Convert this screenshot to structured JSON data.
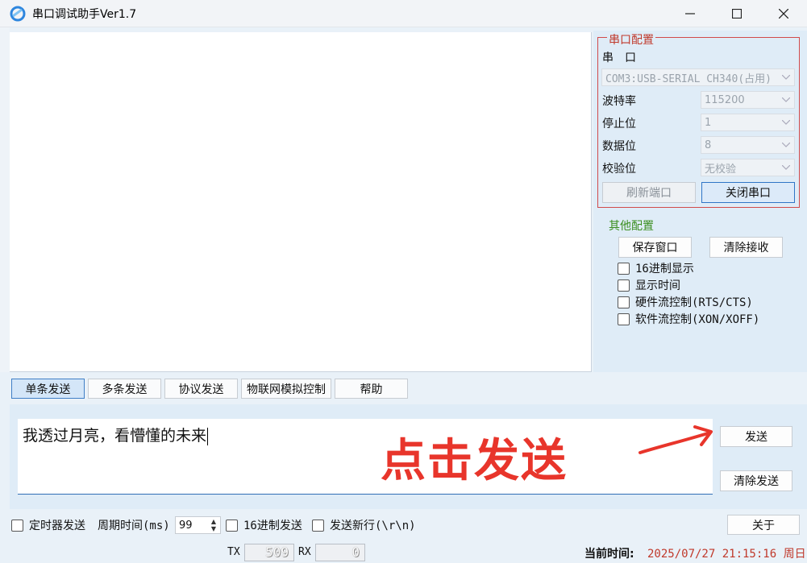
{
  "window": {
    "title": "串口调试助手Ver1.7",
    "controls": {
      "minimize": "—",
      "maximize": "☐",
      "close": "✕"
    }
  },
  "serial_config": {
    "group_title": "串口配置",
    "port_label": "串　口",
    "port_value": "COM3:USB-SERIAL CH340(占用)",
    "baud_label": "波特率",
    "baud_value": "115200",
    "stop_label": "停止位",
    "stop_value": "1",
    "data_label": "数据位",
    "data_value": "8",
    "parity_label": "校验位",
    "parity_value": "无校验",
    "refresh_button": "刷新端口",
    "close_port_button": "关闭串口"
  },
  "other_config": {
    "group_title": "其他配置",
    "save_window_button": "保存窗口",
    "clear_recv_button": "清除接收",
    "checkboxes": [
      {
        "label": "16进制显示",
        "checked": false
      },
      {
        "label": "显示时间",
        "checked": false
      },
      {
        "label": "硬件流控制(RTS/CTS)",
        "checked": false
      },
      {
        "label": "软件流控制(XON/XOFF)",
        "checked": false
      }
    ]
  },
  "tabs": [
    {
      "label": "单条发送",
      "active": true
    },
    {
      "label": "多条发送",
      "active": false
    },
    {
      "label": "协议发送",
      "active": false
    },
    {
      "label": "物联网模拟控制",
      "active": false
    },
    {
      "label": "帮助",
      "active": false
    }
  ],
  "send": {
    "input_value": "我透过月亮，看懵懂的未来",
    "send_button": "发送",
    "clear_send_button": "清除发送",
    "annotation": "点击发送"
  },
  "bottom": {
    "timer_send_label": "定时器发送",
    "period_label": "周期时间(ms)",
    "period_value": "99",
    "hex_send_label": "16进制发送",
    "newline_label": "发送新行(\\r\\n)",
    "about_button": "关于"
  },
  "status": {
    "tx_label": "TX",
    "tx_value": "509",
    "rx_label": "RX",
    "rx_value": "0",
    "time_label": "当前时间:",
    "time_value": "2025/07/27 21:15:16 周日"
  },
  "colors": {
    "accent_red": "#c0392b",
    "accent_green": "#3b8e1f",
    "annotation_red": "#e8352b",
    "panel_bg": "#dfecf7"
  }
}
